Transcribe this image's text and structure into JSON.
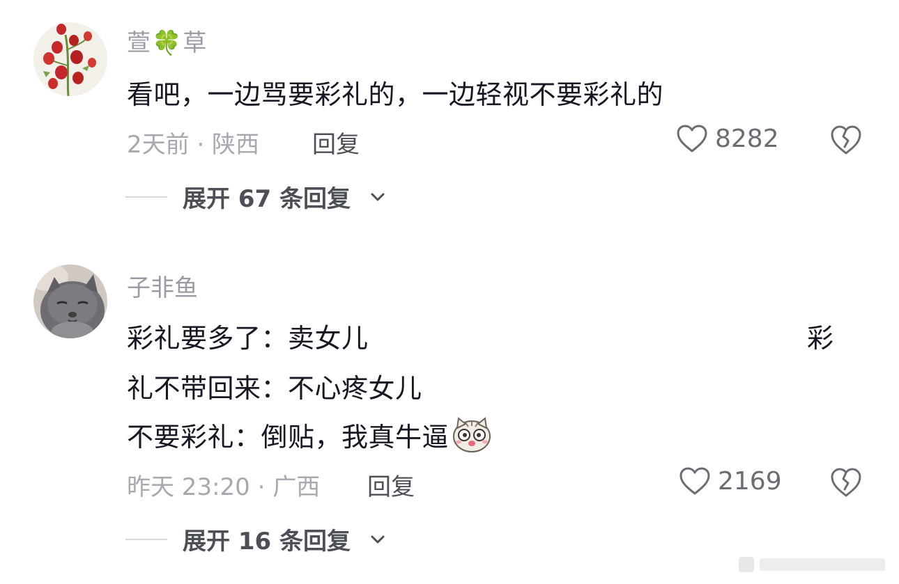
{
  "comments": [
    {
      "username_part1": "萱",
      "username_emoji": "🍀",
      "username_part2": "草",
      "lines": [
        "看吧，一边骂要彩礼的，一边轻视不要彩礼的"
      ],
      "meta": "2天前 · 陕西",
      "reply_label": "回复",
      "likes": "8282",
      "expand_label": "展开 67 条回复",
      "avatar_icon": "red-berries-avatar"
    },
    {
      "username": "子非鱼",
      "lines": [
        "彩礼要多了：卖女儿",
        "礼不带回来：不心疼女儿",
        "不要彩礼：倒贴，我真牛逼"
      ],
      "side_char": "彩",
      "meta": "昨天 23:20 · 广西",
      "reply_label": "回复",
      "likes": "2169",
      "expand_label": "展开 16 条回复",
      "avatar_icon": "gray-cat-avatar",
      "inline_emoji": "surprised-cat-emoji"
    }
  ],
  "colors": {
    "text_primary": "#161823",
    "text_secondary": "#a7a9b0",
    "username": "#9a9ca3",
    "background": "#ffffff"
  }
}
